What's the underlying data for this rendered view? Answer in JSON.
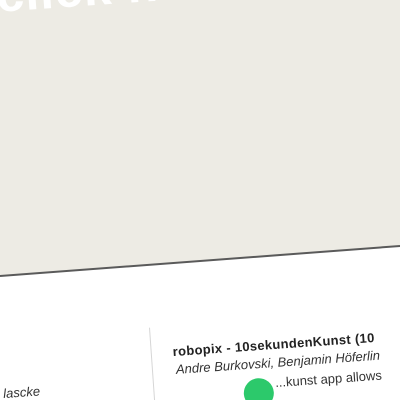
{
  "banner": {
    "text": "click here",
    "background_color": "#edebe4"
  },
  "left_entry": {
    "author_fragment": "lascke"
  },
  "entry": {
    "title": "robopix - 10sekundenKunst (10",
    "authors": "Andre Burkovski, Benjamin Höferlin",
    "description_fragment": "...kunst app allows",
    "icon_color": "#2cc96b",
    "icon": "app-logo-icon"
  }
}
